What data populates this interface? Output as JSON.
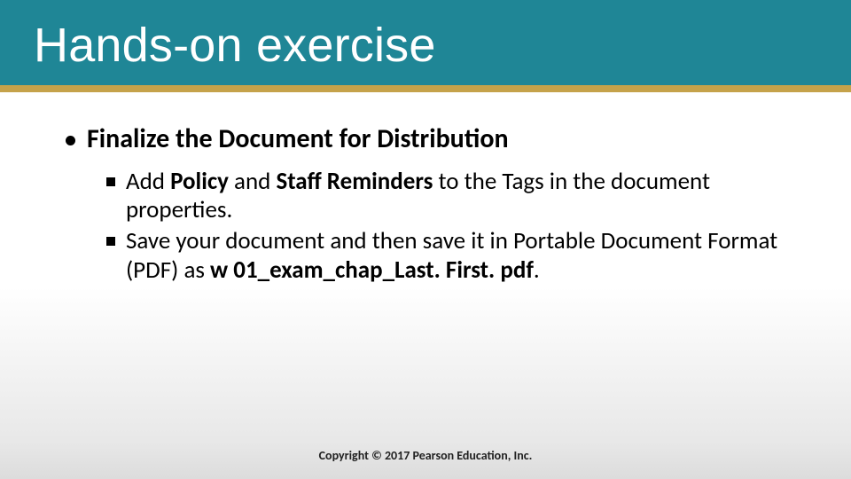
{
  "title": "Hands-on exercise",
  "level1": "Finalize the Document for Distribution",
  "sub": [
    {
      "pre": "Add ",
      "b1": "Policy",
      "mid1": " and ",
      "b2": "Staff Reminders",
      "post": " to the Tags in the document properties."
    },
    {
      "pre": "Save your document and then save it in Portable Document Format (PDF) as ",
      "b1": "w 01_exam_chap_Last. First. pdf",
      "post": "."
    }
  ],
  "footer": "Copyright © 2017 Pearson Education, Inc."
}
